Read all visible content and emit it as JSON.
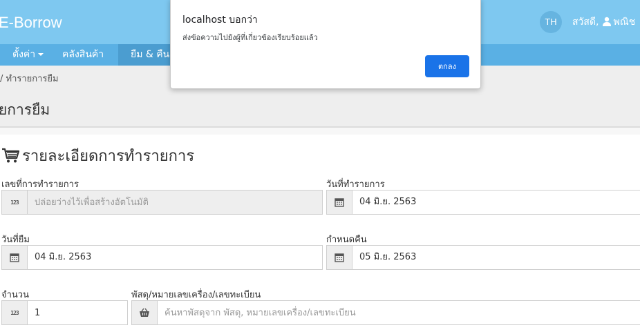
{
  "header": {
    "brand": "E-Borrow",
    "lang_badge": "TH",
    "greeting": "สวัสดี,",
    "user_name": "พณิช"
  },
  "nav": {
    "items": [
      "ตั้งค่า",
      "คลังสินค้า",
      "ยืม & คืน"
    ]
  },
  "breadcrumb": "/ ทำรายการยืม",
  "page_title": "ยการยืม",
  "section": {
    "title": "รายละเอียดการทำรายการ"
  },
  "form": {
    "transaction_no": {
      "label": "เลขที่การทำรายการ",
      "placeholder": "ปล่อยว่างไว้เพื่อสร้างอัตโนมัติ",
      "addon": "123"
    },
    "transaction_date": {
      "label": "วันที่ทำรายการ",
      "value": "04 มิ.ย. 2563"
    },
    "borrow_date": {
      "label": "วันที่ยืม",
      "value": "04 มิ.ย. 2563"
    },
    "due_date": {
      "label": "กำหนดคืน",
      "value": "05 มิ.ย. 2563"
    },
    "quantity": {
      "label": "จำนวน",
      "value": "1",
      "addon": "123"
    },
    "item": {
      "label": "พัสดุ/หมายเลขเครื่อง/เลขทะเบียน",
      "placeholder": "ค้นหาพัสดุจาก พัสดุ, หมายเลขเครื่อง/เลขทะเบียน"
    }
  },
  "dialog": {
    "title": "localhost บอกว่า",
    "message": "ส่งข้อความไปยังผู้ที่เกี่ยวข้องเรียบร้อยแล้ว",
    "ok_label": "ตกลง"
  }
}
